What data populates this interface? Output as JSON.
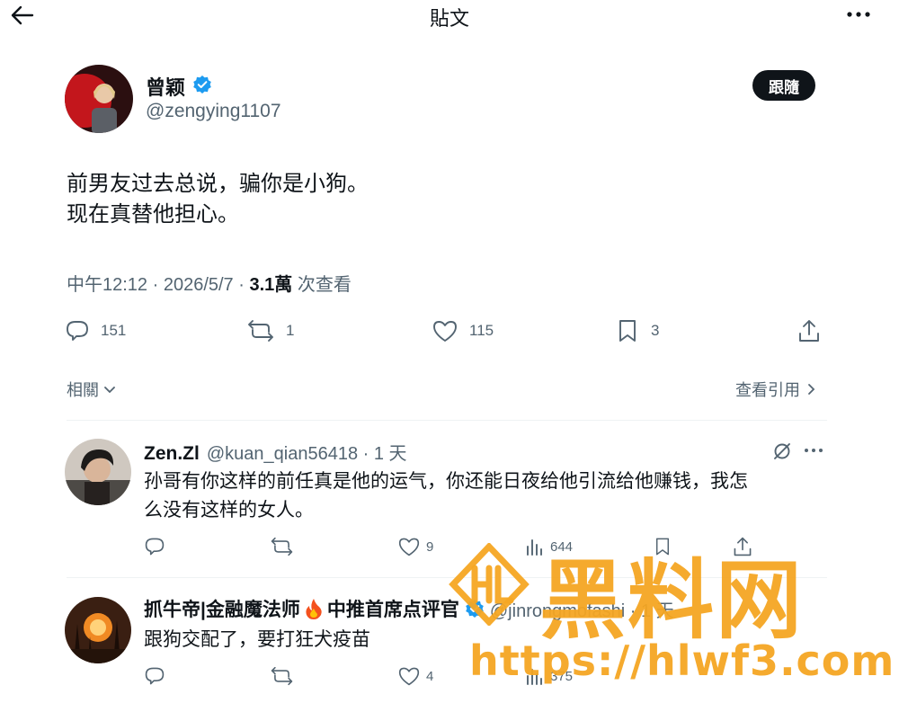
{
  "topbar": {
    "title": "貼文"
  },
  "post": {
    "author_name": "曾颖",
    "author_handle": "@zengying1107",
    "follow_label": "跟隨",
    "text_line1": "前男友过去总说，骗你是小狗。",
    "text_line2": "现在真替他担心。",
    "time": "中午12:12 · 2026/5/7 · ",
    "views_count": "3.1萬",
    "views_label": " 次查看",
    "stats": {
      "replies": "151",
      "reposts": "1",
      "likes": "115",
      "bookmarks": "3"
    }
  },
  "related_label": "相關",
  "quotes_label": "查看引用",
  "replies": [
    {
      "name": "Zen.Zl",
      "handle": "@kuan_qian56418 · 1 天",
      "text_line1": "孙哥有你这样的前任真是他的运气，你还能日夜给他引流给他赚钱，我怎",
      "text_line2": "么没有这样的女人。",
      "likes": "9",
      "views": "644"
    },
    {
      "name": "抓牛帝|金融魔法师",
      "name_suffix": "中推首席点评官",
      "handle": "@jinrongmofashi · 1 天",
      "text_line1": "跟狗交配了，要打狂犬疫苗",
      "likes": "4",
      "views": "375"
    }
  ],
  "watermark": {
    "name": "黑料网",
    "url": "https://hlwf3.com"
  },
  "colors": {
    "text": "#0f1419",
    "secondary": "#536471",
    "verified": "#1d9bf0",
    "watermark": "#f5a623"
  }
}
